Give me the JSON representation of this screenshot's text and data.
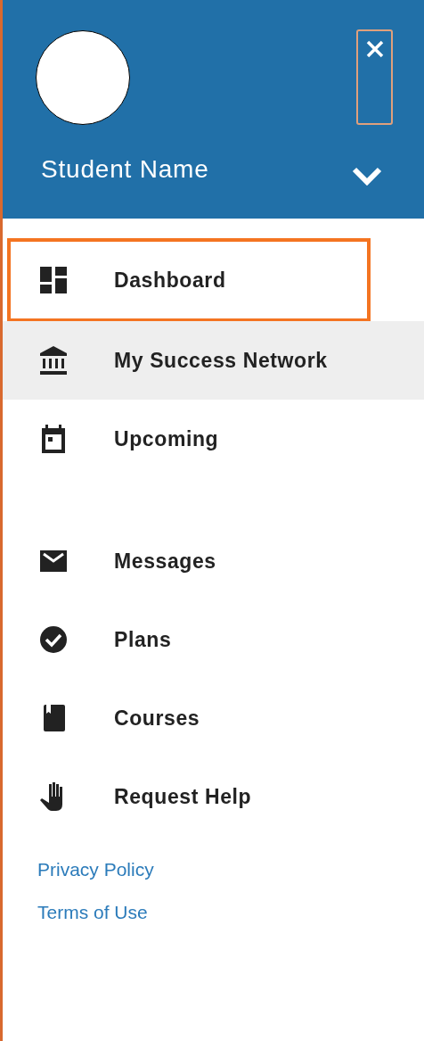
{
  "header": {
    "student_name": "Student Name"
  },
  "nav_groups": [
    [
      {
        "label": "Dashboard",
        "kind": "dashboard",
        "selected": false,
        "focused": true
      },
      {
        "label": "My Success Network",
        "kind": "bank",
        "selected": true,
        "focused": false
      },
      {
        "label": "Upcoming",
        "kind": "calendar",
        "selected": false,
        "focused": false
      }
    ],
    [
      {
        "label": "Messages",
        "kind": "mail",
        "selected": false,
        "focused": false
      },
      {
        "label": "Plans",
        "kind": "check",
        "selected": false,
        "focused": false
      },
      {
        "label": "Courses",
        "kind": "book",
        "selected": false,
        "focused": false
      },
      {
        "label": "Request Help",
        "kind": "hand",
        "selected": false,
        "focused": false
      }
    ]
  ],
  "footer_links": [
    "Privacy Policy",
    "Terms of Use"
  ]
}
